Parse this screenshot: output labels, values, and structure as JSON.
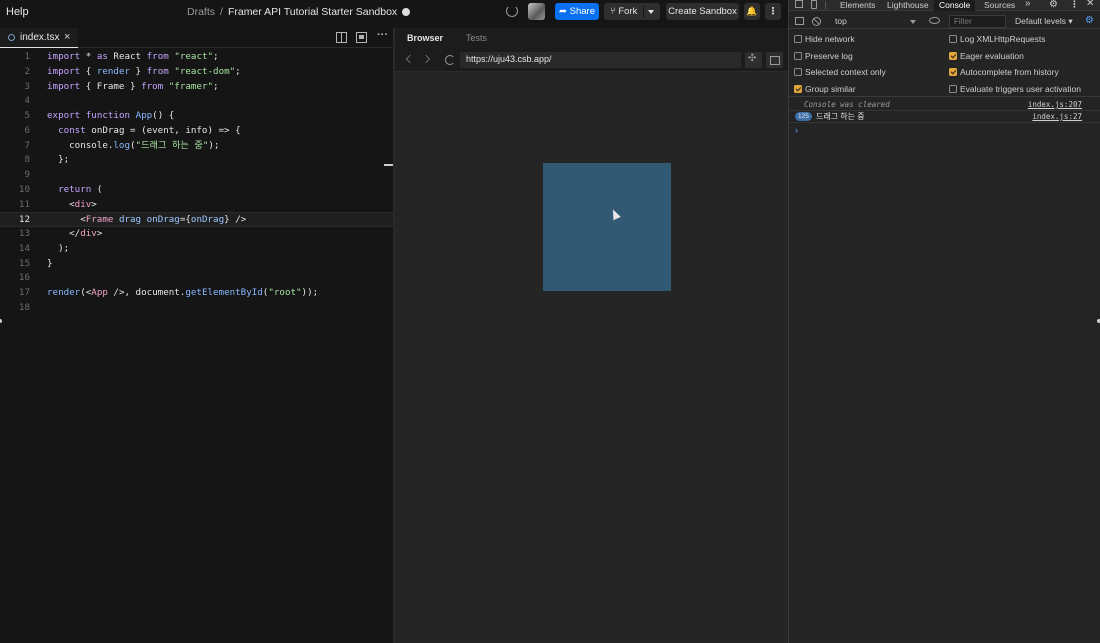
{
  "topbar": {
    "help": "Help",
    "crumb_parent": "Drafts",
    "crumb_sep": "/",
    "sandbox_title": "Framer API Tutorial Starter Sandbox",
    "share": "Share",
    "fork": "Fork",
    "create_sandbox": "Create Sandbox",
    "more": "⋮"
  },
  "editor": {
    "tab_name": "index.tsx",
    "tab_close": "×",
    "more_dots": "···",
    "active_line": 12,
    "lines": [
      "import * as React from \"react\";",
      "import { render } from \"react-dom\";",
      "import { Frame } from \"framer\";",
      "",
      "export function App() {",
      "  const onDrag = (event, info) => {",
      "    console.log(\"드래그 하는 중\");",
      "  };",
      "",
      "  return (",
      "    <div>",
      "      <Frame drag onDrag={onDrag} />",
      "    </div>",
      "  );",
      "}",
      "",
      "render(<App />, document.getElementById(\"root\"));",
      ""
    ]
  },
  "browser": {
    "tabs": [
      "Browser",
      "Tests"
    ],
    "url": "https://uju43.csb.app/",
    "frame_color": "#325973"
  },
  "devtools": {
    "tabs": [
      "Elements",
      "Lighthouse",
      "Console",
      "Sources"
    ],
    "active_tab": "Console",
    "overflow": "»",
    "context": "top",
    "filter_placeholder": "Filter",
    "levels": "Default levels ▾",
    "settings": [
      {
        "label": "Hide network",
        "checked": false
      },
      {
        "label": "Log XMLHttpRequests",
        "checked": false
      },
      {
        "label": "Preserve log",
        "checked": false
      },
      {
        "label": "Eager evaluation",
        "checked": true
      },
      {
        "label": "Selected context only",
        "checked": false
      },
      {
        "label": "Autocomplete from history",
        "checked": true
      },
      {
        "label": "Group similar",
        "checked": true
      },
      {
        "label": "Evaluate triggers user activation",
        "checked": false
      }
    ],
    "messages": [
      {
        "text": "Console was cleared",
        "source": "index.js:207"
      },
      {
        "count": "125",
        "text": "드래그 하는 중",
        "source": "index.js:27"
      }
    ],
    "prompt": "›"
  },
  "colors": {
    "accent": "#0971f1",
    "checkbox_on": "#e0a63a",
    "badge": "#3d6fa8"
  }
}
